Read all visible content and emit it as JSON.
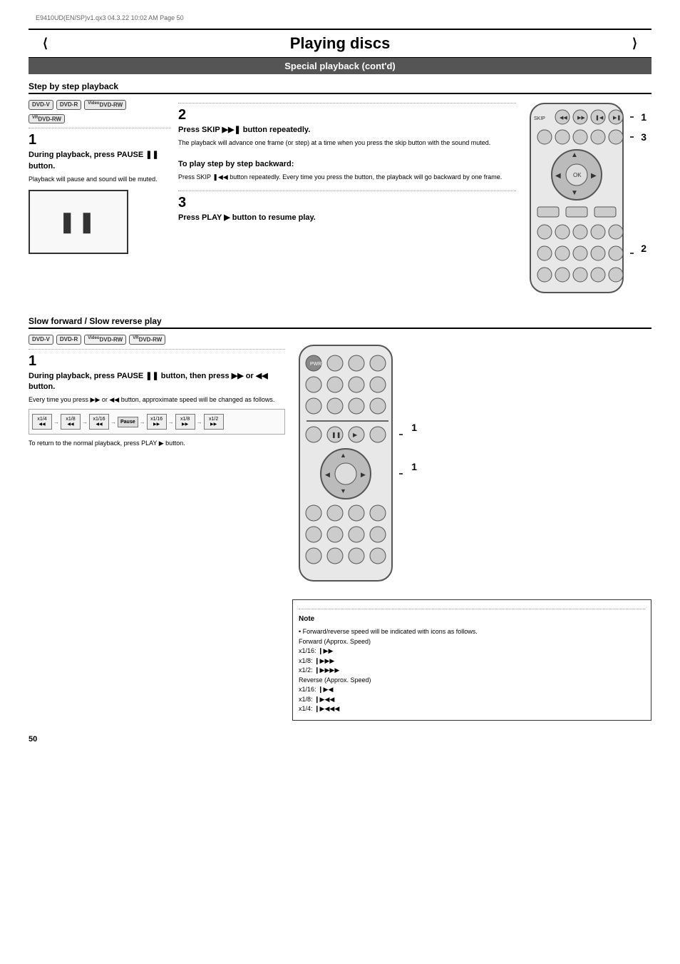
{
  "file_info": "E9410UD(EN/SP)v1.qx3   04.3.22   10:02 AM   Page 50",
  "main_title": "Playing discs",
  "sub_title": "Special playback (cont'd)",
  "section1": {
    "header": "Step by step playback",
    "step1": {
      "num": "1",
      "title": "During playback, press PAUSE ❚❚ button.",
      "desc": "Playback will pause and sound will be muted."
    },
    "step2": {
      "num": "2",
      "title": "Press SKIP ▶▶❚ button repeatedly.",
      "desc": "The playback will advance one frame (or step) at a time when you press the skip button with the sound muted.",
      "subtitle2": "To play step by step backward:",
      "desc2": "Press SKIP ❚◀◀ button repeatedly. Every time you press the button, the playback will go backward by one frame."
    },
    "step3": {
      "num": "3",
      "title": "Press PLAY ▶ button to resume play."
    }
  },
  "section2": {
    "header": "Slow forward / Slow reverse play",
    "step1": {
      "num": "1",
      "title": "During playback, press PAUSE ❚❚ button, then press ▶▶ or ◀◀ button.",
      "desc": "Every time you press ▶▶ or ◀◀ button, approximate speed will be changed as follows."
    },
    "return_note": "To return to the normal playback, press PLAY ▶ button.",
    "speed_labels": [
      "x1/4",
      "x1/8",
      "x1/16",
      "Pause",
      "x1/16",
      "x1/8",
      "x1/2"
    ],
    "speed_arrows_left": [
      "◀◀",
      "◀◀",
      "◀◀"
    ],
    "speed_arrows_right": [
      "▶▶",
      "▶▶",
      "▶▶"
    ]
  },
  "note": {
    "title": "Note",
    "items": [
      "Forward/reverse speed will be indicated with icons as follows.",
      "Forward (Approx. Speed)",
      "x1/16: ❙▶▶",
      "x1/8:  ❙▶▶▶",
      "x1/2:  ❙▶▶▶▶",
      "Reverse (Approx. Speed)",
      "x1/16: ❙▶◀",
      "x1/8:  ❙▶◀◀",
      "x1/4:  ❙▶◀◀◀"
    ]
  },
  "page_number": "50",
  "badges": [
    "DVD-V",
    "DVD-R",
    "Video DVD-RW",
    "VR DVD-RW"
  ],
  "badges2": [
    "DVD-V",
    "DVD-R",
    "Video DVD-RW",
    "VR DVD-RW"
  ],
  "callouts_top": {
    "c1": "1",
    "c2": "2",
    "c3": "3"
  },
  "callouts_bottom": {
    "c1": "1"
  }
}
